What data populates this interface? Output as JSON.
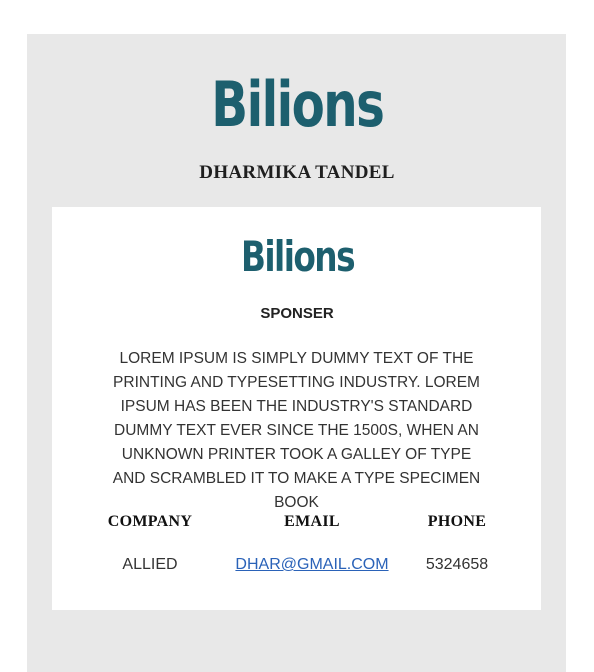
{
  "header": {
    "logo_text": "Bilions",
    "name": "DHARMIKA TANDEL"
  },
  "card": {
    "logo_text": "Bilions",
    "heading": "SPONSER",
    "description": "LOREM IPSUM IS SIMPLY DUMMY TEXT OF THE PRINTING AND TYPESETTING INDUSTRY. LOREM IPSUM HAS BEEN THE INDUSTRY'S STANDARD DUMMY TEXT EVER SINCE THE 1500S, WHEN AN UNKNOWN PRINTER TOOK A GALLEY OF TYPE AND SCRAMBLED IT TO MAKE A TYPE SPECIMEN BOOK",
    "table": {
      "headers": [
        "COMPANY",
        "EMAIL",
        "PHONE"
      ],
      "row": {
        "company": "ALLIED",
        "email": "DHAR@GMAIL.COM",
        "phone": "5324658"
      }
    }
  },
  "colors": {
    "logo": "#1d5f6e",
    "background": "#e8e8e8",
    "link": "#2a62b8"
  }
}
